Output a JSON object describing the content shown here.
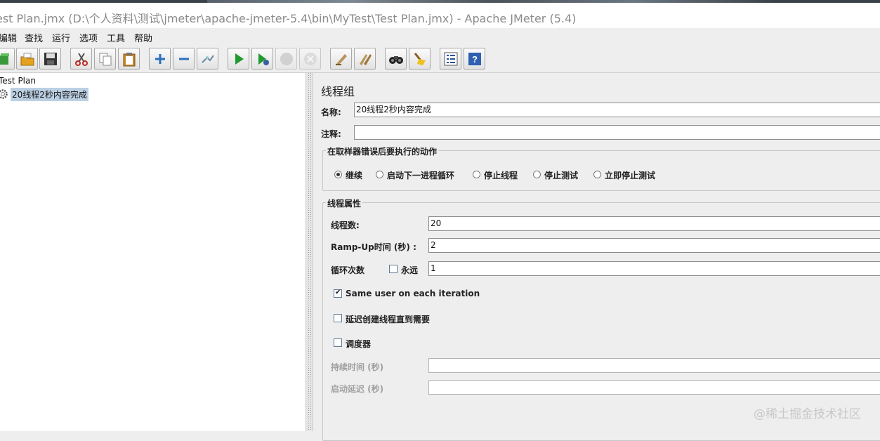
{
  "window": {
    "title": "est Plan.jmx (D:\\个人资料\\测试\\jmeter\\apache-jmeter-5.4\\bin\\MyTest\\Test Plan.jmx) - Apache JMeter (5.4)"
  },
  "menu": {
    "items": [
      "编辑",
      "查找",
      "运行",
      "选项",
      "工具",
      "帮助"
    ]
  },
  "toolbar": {
    "buttons": [
      {
        "icon": "templates-icon",
        "enabled": true
      },
      {
        "icon": "open-icon",
        "enabled": true
      },
      {
        "icon": "save-icon",
        "enabled": true
      },
      {
        "icon": "cut-icon",
        "enabled": true
      },
      {
        "icon": "copy-icon",
        "enabled": true
      },
      {
        "icon": "paste-icon",
        "enabled": true
      },
      {
        "icon": "expand-icon",
        "enabled": true
      },
      {
        "icon": "collapse-icon",
        "enabled": true
      },
      {
        "icon": "toggle-icon",
        "enabled": true
      },
      {
        "icon": "start-icon",
        "enabled": true
      },
      {
        "icon": "start-no-pauses-icon",
        "enabled": true
      },
      {
        "icon": "stop-icon",
        "enabled": false
      },
      {
        "icon": "shutdown-icon",
        "enabled": false
      },
      {
        "icon": "clear-icon",
        "enabled": true
      },
      {
        "icon": "clear-all-icon",
        "enabled": true
      },
      {
        "icon": "search-icon",
        "enabled": true
      },
      {
        "icon": "reset-search-icon",
        "enabled": true
      },
      {
        "icon": "function-helper-icon",
        "enabled": true
      },
      {
        "icon": "help-icon",
        "enabled": true
      }
    ]
  },
  "tree": {
    "root": "Test Plan",
    "selected_node": "20线程2秒内容完成"
  },
  "panel": {
    "heading": "线程组",
    "name_label": "名称:",
    "name_value": "20线程2秒内容完成",
    "comment_label": "注释:",
    "comment_value": "",
    "error_action": {
      "legend": "在取样器错误后要执行的动作",
      "options": [
        "继续",
        "启动下一进程循环",
        "停止线程",
        "停止测试",
        "立即停止测试"
      ],
      "selected": "继续"
    },
    "thread_props": {
      "legend": "线程属性",
      "threads_label": "线程数:",
      "threads_value": "20",
      "rampup_label": "Ramp-Up时间 (秒) :",
      "rampup_value": "2",
      "loop_label": "循环次数",
      "forever_label": "永远",
      "forever_checked": false,
      "loop_value": "1",
      "same_user_label": "Same user on each iteration",
      "same_user_checked": true,
      "delay_label": "延迟创建线程直到需要",
      "delay_checked": false,
      "scheduler_label": "调度器",
      "scheduler_checked": false,
      "duration_label": "持续时间 (秒)",
      "duration_value": "",
      "startup_delay_label": "启动延迟 (秒)",
      "startup_delay_value": ""
    }
  },
  "watermark": "@稀土掘金技术社区"
}
